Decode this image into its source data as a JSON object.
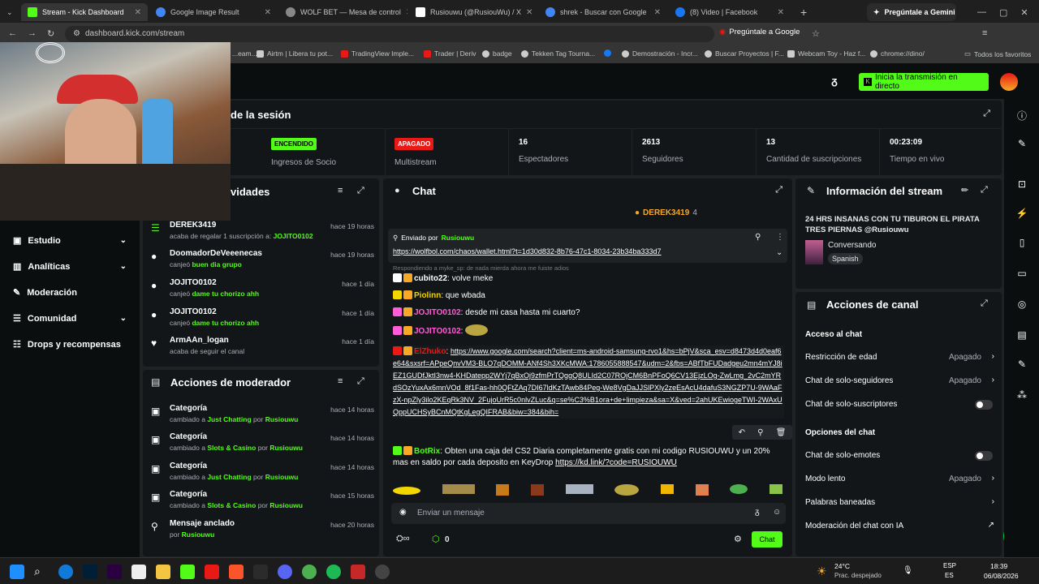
{
  "tabs": [
    {
      "title": "Stream - Kick Dashboard",
      "color": "#53fc18"
    },
    {
      "title": "Google Image Result",
      "color": "#4285f4"
    },
    {
      "title": "WOLF BET — Mesa de control",
      "color": "#888888"
    },
    {
      "title": "Rusiouwu (@RusiouWu) / X",
      "color": "#ffffff"
    },
    {
      "title": "shrek - Buscar con Google",
      "color": "#4285f4"
    },
    {
      "title": "(8) Video | Facebook",
      "color": "#1877f2"
    }
  ],
  "gemini_tab": "Pregúntale a Gemini",
  "url": "dashboard.kick.com/stream",
  "ask_google": "Pregúntale a Google",
  "bookmarks": [
    "...eam...",
    "Airtm | Libera tu pot...",
    "TradingView Imple...",
    "Trader | Deriv",
    "badge",
    "Tekken Tag Tourna...",
    "",
    "Demostración - Incr...",
    "Buscar Proyectos | F...",
    "Webcam Toy - Haz f...",
    "chrome://dino/",
    "Todos los favoritos"
  ],
  "header": {
    "go_live": "Inicia la transmisión en directo"
  },
  "session": {
    "title": "de la sesión",
    "partner_badge": "ENCENDIDO",
    "partner_label": "Ingresos de Socio",
    "multistream_badge": "APAGADO",
    "multistream_label": "Multistream",
    "viewers": "16",
    "viewers_label": "Espectadores",
    "followers": "2613",
    "followers_label": "Seguidores",
    "subs": "13",
    "subs_label": "Cantidad de suscripciones",
    "time": "00:23:09",
    "time_label": "Tiempo en vivo"
  },
  "sidebar": [
    {
      "label": "Estudio",
      "chev": true
    },
    {
      "label": "Analíticas",
      "chev": true
    },
    {
      "label": "Moderación",
      "chev": false
    },
    {
      "label": "Comunidad",
      "chev": true
    },
    {
      "label": "Drops y recompensas",
      "chev": false
    }
  ],
  "activity": {
    "title": "vidades",
    "items": [
      {
        "user": "DEREK3419",
        "sub": "acaba de regalar 1 suscripción a:",
        "target": "JOJITO0102",
        "time": "hace 19 horas"
      },
      {
        "user": "DoomadorDeVeeenecas",
        "sub": "canjeó",
        "target": "buen dia grupo",
        "time": "hace 19 horas"
      },
      {
        "user": "JOJITO0102",
        "sub": "canjeó",
        "target": "dame tu chorizo ahh",
        "time": "hace 1 día"
      },
      {
        "user": "JOJITO0102",
        "sub": "canjeó",
        "target": "dame tu chorizo ahh",
        "time": "hace 1 día"
      },
      {
        "user": "ArmAAn_logan",
        "sub": "acaba de seguir el canal",
        "target": "",
        "time": "hace 1 día"
      }
    ]
  },
  "modactions": {
    "title": "Acciones de moderador",
    "items": [
      {
        "title": "Categoría",
        "pre": "cambiado a",
        "val": "Just Chatting",
        "by": "por",
        "mod": "Rusiouwu",
        "time": "hace 14 horas"
      },
      {
        "title": "Categoría",
        "pre": "cambiado a",
        "val": "Slots & Casino",
        "by": "por",
        "mod": "Rusiouwu",
        "time": "hace 14 horas"
      },
      {
        "title": "Categoría",
        "pre": "cambiado a",
        "val": "Just Chatting",
        "by": "por",
        "mod": "Rusiouwu",
        "time": "hace 14 horas"
      },
      {
        "title": "Categoría",
        "pre": "cambiado a",
        "val": "Slots & Casino",
        "by": "por",
        "mod": "Rusiouwu",
        "time": "hace 15 horas"
      },
      {
        "title": "Mensaje anclado",
        "pre": "por",
        "val": "Rusiouwu",
        "by": "",
        "mod": "",
        "time": "hace 20 horas"
      }
    ]
  },
  "chat": {
    "title": "Chat",
    "top_gifter": "DEREK3419",
    "top_gifter_count": "4",
    "pinned_by": "Enviado por",
    "pinned_user": "Rusiouwu",
    "pinned_link": "https://wolfbol.com/chaos/wallet.html?t=1d30d832-8b76-47c1-8034-23b34ba333d7",
    "reply_hint": "Respondiendo a myke_sp: de nada mierda ahora me fuiste adios",
    "messages": [
      {
        "user": "cubito22",
        "color": "#ffffff",
        "text": "volve meke"
      },
      {
        "user": "Piolinn",
        "color": "#f2d600",
        "text": "que wbada"
      },
      {
        "user": "JOJITO0102",
        "color": "#ff5cd6",
        "text": "desde mi casa hasta mi cuarto?"
      },
      {
        "user": "JOJITO0102",
        "color": "#ff5cd6",
        "text": ""
      },
      {
        "user": "ElZhuko",
        "color": "#e91916",
        "text": "https://www.google.com/search?client=ms-android-samsung-rvo1&hs=bPjV&sca_esv=d8473d4d0eaf6e64&sxsrf=APpeQnvVM3-BLO7qDOMM-ANf4Sh3XKcMWA:1786055888547&udm=2&fbs=ABfTbFUDadgeu2mn4mYJ8iEZ1GUDfJktI3nw4-KHDatepp2WYj7qBxOj9zfmPrTQggQ8ULId2C07ROjCM6BnPFoQ6CV13EjzLOg-ZwLmg_2vC2mYRdSOzYuxAx6mnVOd_8f1Fas-hh0QFtZAq7DI67ldKzTAwb84Peg-We8VgDaJJSlPXly2zeEsAcU4dafuS3NGZP7U-9WAaFzX-npZly3ilo2KEqRk3NV_2FujoUrR5c0nlvZLuc&q=se%C3%B1ora+de+limpieza&sa=X&ved=2ahUKEwiogeTWI-2WAxUQppUCHSyBCnMQtKgLegQIFRAB&biw=384&bih="
      },
      {
        "user": "BotRix",
        "color": "#53fc18",
        "text": "Obten una caja del CS2 Diaria completamente gratis con mi codigo RUSIOUWU y un 20% mas en saldo por cada deposito en KeyDrop",
        "link": "https://kd.link/?code=RUSIOUWU"
      }
    ],
    "input_placeholder": "Enviar un mensaje",
    "points": "0",
    "send_label": "Chat"
  },
  "info": {
    "title": "Información del stream",
    "stream_title": "24 HRS INSANAS CON TU TIBURON EL PIRATA TRES PIERNAS @Rusiouwu",
    "category": "Conversando",
    "language": "Spanish"
  },
  "channel": {
    "title": "Acciones de canal",
    "chat_access": "Acceso al chat",
    "age": "Restricción de edad",
    "age_val": "Apagado",
    "followers_only": "Chat de solo-seguidores",
    "followers_val": "Apagado",
    "subs_only": "Chat de solo-suscriptores",
    "chat_options": "Opciones del chat",
    "emotes_only": "Chat de solo-emotes",
    "slow": "Modo lento",
    "slow_val": "Apagado",
    "banned": "Palabras baneadas",
    "ai_mod": "Moderación del chat con IA"
  },
  "taskbar": {
    "weather_temp": "24°C",
    "weather_desc": "Prac. despejado",
    "lang1": "ESP",
    "lang2": "ES",
    "time": "18:39",
    "date": "06/08/2026"
  }
}
